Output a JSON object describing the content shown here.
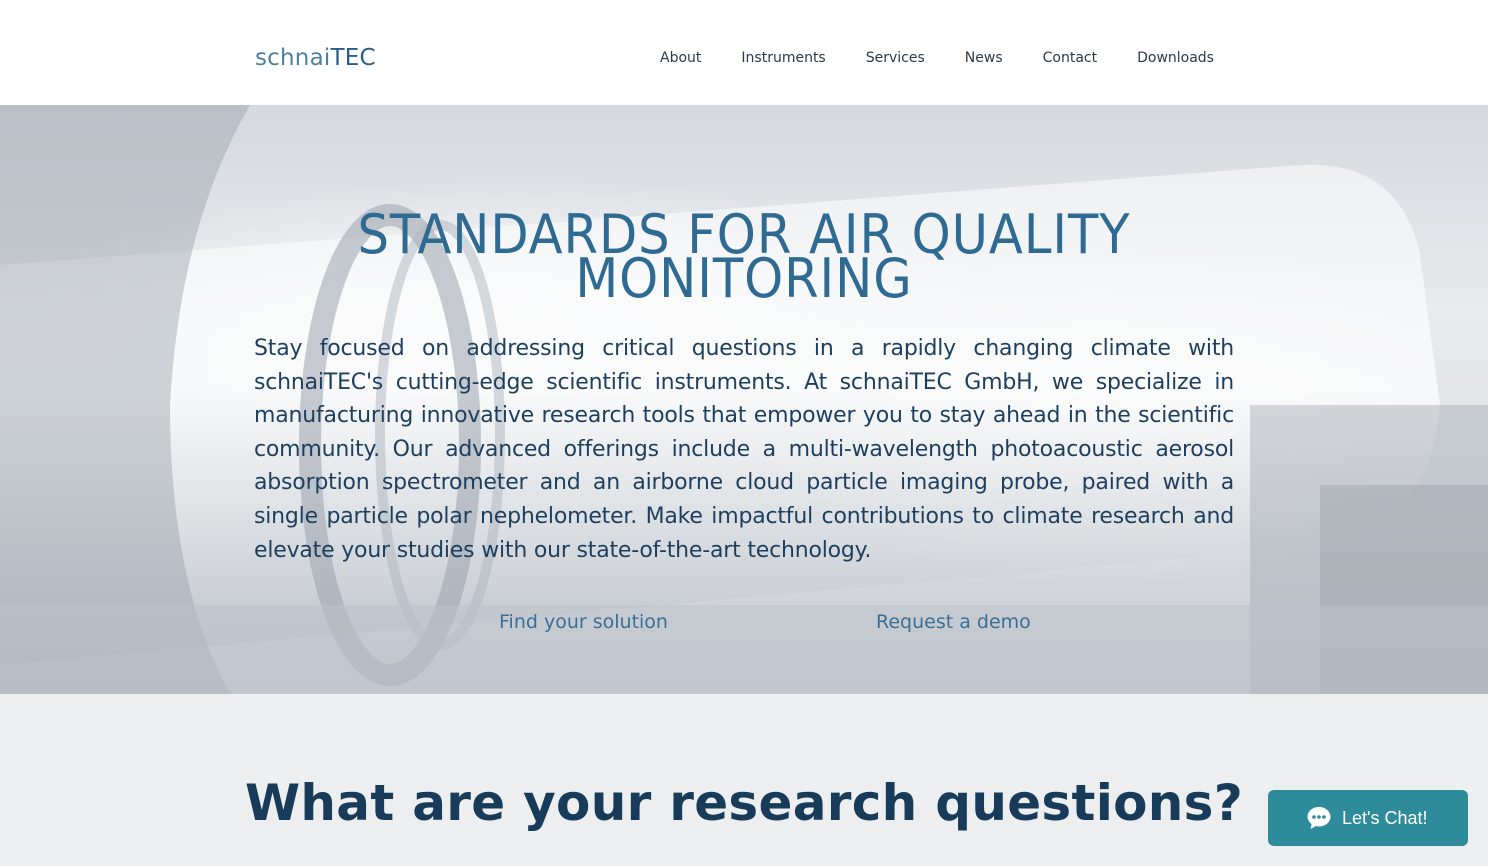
{
  "header": {
    "logo_part1": "schnai",
    "logo_part2": "TEC",
    "nav": [
      "About",
      "Instruments",
      "Services",
      "News",
      "Contact",
      "Downloads"
    ]
  },
  "hero": {
    "title_line1": "STANDARDS FOR AIR QUALITY",
    "title_line2": "MONITORING",
    "description": "Stay focused on addressing critical questions in a rapidly changing climate with schnaiTEC's cutting-edge scientific instruments. At schnaiTEC GmbH, we specialize in manufacturing innovative research tools that empower you to stay ahead in the scientific community. Our advanced offerings include a multi-wavelength photoacoustic aerosol absorption spectrometer and an airborne cloud particle imaging probe, paired with a single particle polar nephelometer. Make impactful contributions to climate research and elevate your studies with our state-of-the-art technology.",
    "button_find": "Find your solution",
    "button_demo": "Request a demo"
  },
  "research": {
    "title": "What are your research questions?"
  },
  "chat": {
    "label": "Let's Chat!"
  },
  "colors": {
    "brand_blue": "#2f6a93",
    "dark_text": "#1d3f5f",
    "chat_teal": "#2e8b9a",
    "section_bg": "#eceef0"
  }
}
